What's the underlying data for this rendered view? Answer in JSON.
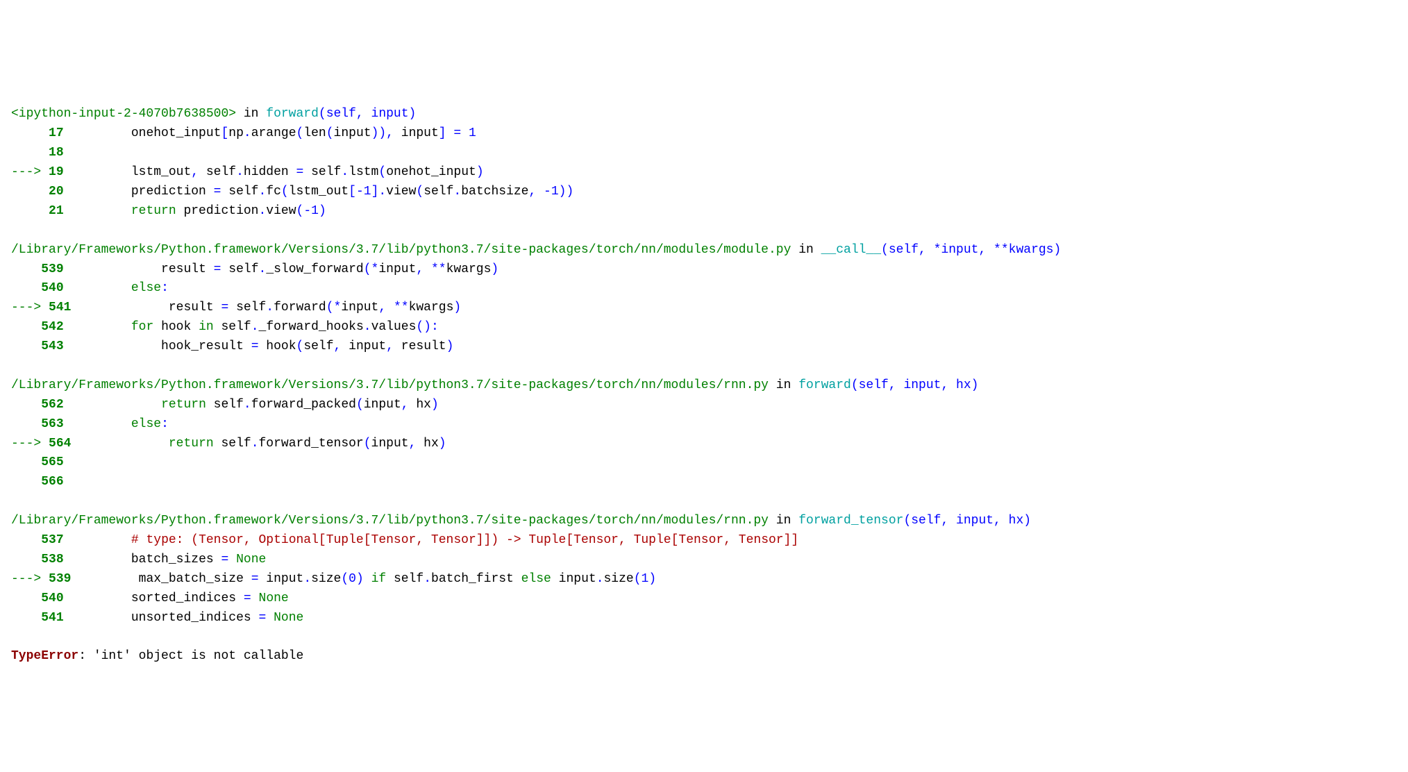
{
  "frame1": {
    "location_pre": "<ipython-input-2-4070b7638500>",
    "in": " in ",
    "func": "forward",
    "sig_open": "(self, input)",
    "l17_no": "     17 ",
    "l17_code_a": "        onehot_input",
    "l17_code_b": "[",
    "l17_code_c": "np",
    "l17_code_d": ".",
    "l17_code_e": "arange",
    "l17_code_f": "(",
    "l17_code_g": "len",
    "l17_code_h": "(",
    "l17_code_i": "input",
    "l17_code_j": ")),",
    "l17_code_k": " input",
    "l17_code_l": "]",
    "l17_code_m": " = ",
    "l17_code_n": "1",
    "l18_no": "     18 ",
    "arrow": "---> ",
    "l19_no": "19 ",
    "l19_a": "        lstm_out",
    "l19_b": ",",
    "l19_c": " self",
    "l19_d": ".",
    "l19_e": "hidden ",
    "l19_f": "=",
    "l19_g": " self",
    "l19_h": ".",
    "l19_i": "lstm",
    "l19_j": "(",
    "l19_k": "onehot_input",
    "l19_l": ")",
    "l20_no": "     20 ",
    "l20_a": "        prediction ",
    "l20_b": "=",
    "l20_c": " self",
    "l20_d": ".",
    "l20_e": "fc",
    "l20_f": "(",
    "l20_g": "lstm_out",
    "l20_h": "[-",
    "l20_i": "1",
    "l20_j": "].",
    "l20_k": "view",
    "l20_l": "(",
    "l20_m": "self",
    "l20_n": ".",
    "l20_o": "batchsize",
    "l20_p": ", -",
    "l20_q": "1",
    "l20_r": "))",
    "l21_no": "     21 ",
    "l21_a": "        ",
    "l21_b": "return",
    "l21_c": " prediction",
    "l21_d": ".",
    "l21_e": "view",
    "l21_f": "(-",
    "l21_g": "1",
    "l21_h": ")"
  },
  "frame2": {
    "path": "/Library/Frameworks/Python.framework/Versions/3.7/lib/python3.7/site-packages/torch/nn/modules/module.py",
    "in": " in ",
    "func": "__call__",
    "sig": "(self, *input, **kwargs)",
    "l539_no": "    539 ",
    "l539_a": "            result ",
    "l539_b": "=",
    "l539_c": " self",
    "l539_d": ".",
    "l539_e": "_slow_forward",
    "l539_f": "(*",
    "l539_g": "input",
    "l539_h": ", **",
    "l539_i": "kwargs",
    "l539_j": ")",
    "l540_no": "    540 ",
    "l540_a": "        ",
    "l540_b": "else",
    "l540_c": ":",
    "l541_no": "541 ",
    "l541_a": "            result ",
    "l541_b": "=",
    "l541_c": " self",
    "l541_d": ".",
    "l541_e": "forward",
    "l541_f": "(*",
    "l541_g": "input",
    "l541_h": ", **",
    "l541_i": "kwargs",
    "l541_j": ")",
    "l542_no": "    542 ",
    "l542_a": "        ",
    "l542_b": "for",
    "l542_c": " hook ",
    "l542_d": "in",
    "l542_e": " self",
    "l542_f": ".",
    "l542_g": "_forward_hooks",
    "l542_h": ".",
    "l542_i": "values",
    "l542_j": "():",
    "l543_no": "    543 ",
    "l543_a": "            hook_result ",
    "l543_b": "=",
    "l543_c": " hook",
    "l543_d": "(",
    "l543_e": "self",
    "l543_f": ",",
    "l543_g": " input",
    "l543_h": ",",
    "l543_i": " result",
    "l543_j": ")"
  },
  "frame3": {
    "path": "/Library/Frameworks/Python.framework/Versions/3.7/lib/python3.7/site-packages/torch/nn/modules/rnn.py",
    "in": " in ",
    "func": "forward",
    "sig": "(self, input, hx)",
    "l562_no": "    562 ",
    "l562_a": "            ",
    "l562_b": "return",
    "l562_c": " self",
    "l562_d": ".",
    "l562_e": "forward_packed",
    "l562_f": "(",
    "l562_g": "input",
    "l562_h": ",",
    "l562_i": " hx",
    "l562_j": ")",
    "l563_no": "    563 ",
    "l563_a": "        ",
    "l563_b": "else",
    "l563_c": ":",
    "l564_no": "564 ",
    "l564_a": "            ",
    "l564_b": "return",
    "l564_c": " self",
    "l564_d": ".",
    "l564_e": "forward_tensor",
    "l564_f": "(",
    "l564_g": "input",
    "l564_h": ",",
    "l564_i": " hx",
    "l564_j": ")",
    "l565_no": "    565 ",
    "l566_no": "    566 "
  },
  "frame4": {
    "path": "/Library/Frameworks/Python.framework/Versions/3.7/lib/python3.7/site-packages/torch/nn/modules/rnn.py",
    "in": " in ",
    "func": "forward_tensor",
    "sig": "(self, input, hx)",
    "l537_no": "    537 ",
    "l537_a": "        ",
    "l537_b": "# type: (Tensor, Optional[Tuple[Tensor, Tensor]]) -> Tuple[Tensor, Tuple[Tensor, Tensor]]",
    "l538_no": "    538 ",
    "l538_a": "        batch_sizes ",
    "l538_b": "=",
    "l538_c": " ",
    "l538_d": "None",
    "l539_no": "539 ",
    "l539_a": "        max_batch_size ",
    "l539_b": "=",
    "l539_c": " input",
    "l539_d": ".",
    "l539_e": "size",
    "l539_f": "(",
    "l539_g": "0",
    "l539_h": ")",
    "l539_i": " ",
    "l539_j": "if",
    "l539_k": " self",
    "l539_l": ".",
    "l539_m": "batch_first ",
    "l539_n": "else",
    "l539_o": " input",
    "l539_p": ".",
    "l539_q": "size",
    "l539_r": "(",
    "l539_s": "1",
    "l539_t": ")",
    "l540_no": "    540 ",
    "l540_a": "        sorted_indices ",
    "l540_b": "=",
    "l540_c": " ",
    "l540_d": "None",
    "l541_no": "    541 ",
    "l541_a": "        unsorted_indices ",
    "l541_b": "=",
    "l541_c": " ",
    "l541_d": "None"
  },
  "error": {
    "type": "TypeError",
    "sep": ": ",
    "msg": "'int' object is not callable"
  }
}
